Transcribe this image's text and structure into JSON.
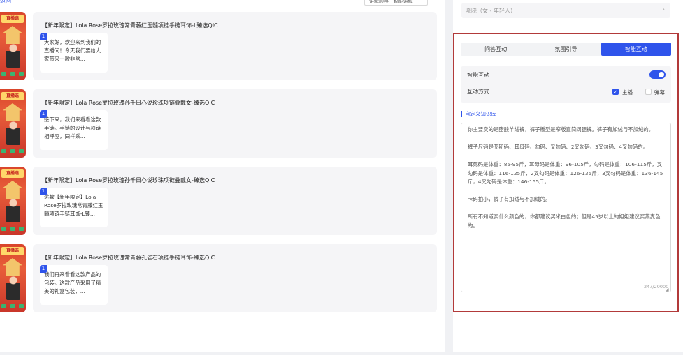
{
  "header": {
    "top_link": "返回",
    "top_select": "讲解顺序 · 智能讲解"
  },
  "products": [
    {
      "title": "【新年限定】Lola Rose罗拉玫瑰常青藤红玉髓项链手链耳饰-L臻选QIC",
      "note_num": "1",
      "note_text": "大家好，欢迎来到我们的直播间！今天我们要给大家带来一款非常..."
    },
    {
      "title": "【新年限定】Lola Rose罗拉玫瑰孙千日心说珍珠项链叠戴女-臻选QIC",
      "note_num": "1",
      "note_text": "接下来，我们来看看这款手链。手链的设计与项链相呼应，同样采..."
    },
    {
      "title": "【新年限定】Lola Rose罗拉玫瑰孙千日心说珍珠项链叠戴女-臻选QIC",
      "note_num": "1",
      "note_text": "这款【新年限定】Lola Rose罗拉玫瑰常青藤红玉髓项链手链耳饰-L臻..."
    },
    {
      "title": "【新年限定】Lola Rose罗拉玫瑰常青藤孔雀石项链手链耳饰-臻选QIC",
      "note_num": "1",
      "note_text": "我们再来看看这款产品的包装。这款产品采用了精美的礼盒包装，..."
    }
  ],
  "voice": {
    "value": "晓晓（女 - 年轻人）",
    "chevron": "›"
  },
  "tabs": [
    {
      "label": "问答互动",
      "active": false
    },
    {
      "label": "氛围引导",
      "active": false
    },
    {
      "label": "智能互动",
      "active": true
    }
  ],
  "settings": {
    "smart_label": "智能互动",
    "smart_on": true,
    "mode_label": "互动方式",
    "option_host": "主播",
    "option_host_checked": true,
    "option_popup": "弹幕",
    "option_popup_checked": false
  },
  "knowledge": {
    "title": "自定义知识库",
    "paragraphs": [
      "你主要卖的是醋酸羊绒裤，裤子版型是窄版直筒阔腿裤。裤子有加绒与不加绒的。",
      "裤子尺码是艾斯码、耳母码、勾码、叉勾码、2叉勾码、3叉勾码、4叉勾码的。",
      "耳死码是体重：85-95斤，耳母码是体重：96-105斤，勾码是体重：106-115斤，叉勾码是体重：116-125斤，2叉勾码是体重：126-135斤，3叉勾码是体重：136-145斤，4叉勾码是体重：146-155斤。",
      "卡码拍小，裤子有加绒与不加绒的。",
      "所有不知道买什么颜色的，你都建议买米白色的；但是45岁以上的姐姐建议买燕麦色的。"
    ],
    "count": "247/20000",
    "resize_glyph": "◢"
  },
  "colors": {
    "accent": "#2f54eb",
    "highlight_border": "#b23a3a",
    "card_bg": "#f5f5f7"
  },
  "thumb": {
    "banner": "直播选"
  }
}
